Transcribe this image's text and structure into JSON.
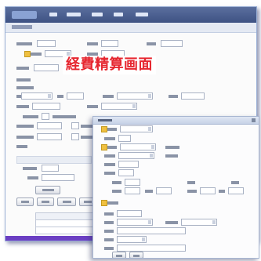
{
  "overlay": {
    "title": "経費精算画面",
    "title_color": "#e6262f"
  },
  "colors": {
    "menubar": "#3e5283",
    "window_border": "#9ab0d6",
    "purple_edge": "#6b3fc3"
  }
}
